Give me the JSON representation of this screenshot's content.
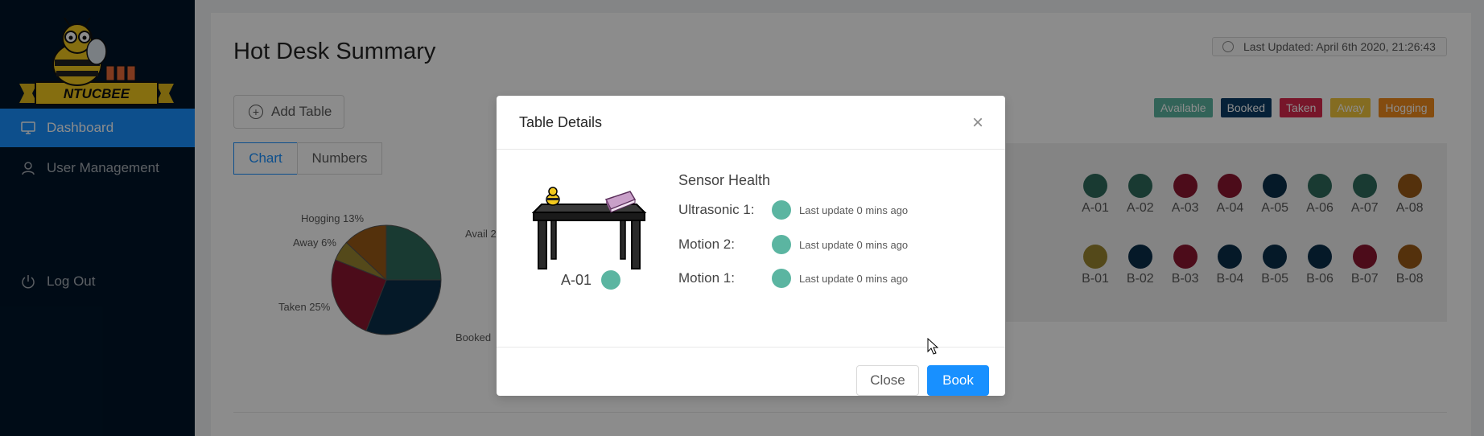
{
  "sidebar": {
    "brand": "NTUCBEE",
    "items": [
      {
        "label": "Dashboard",
        "icon": "desktop-icon",
        "active": true
      },
      {
        "label": "User Management",
        "icon": "user-icon",
        "active": false
      },
      {
        "label": "Log Out",
        "icon": "power-icon",
        "active": false
      }
    ]
  },
  "header": {
    "title": "Hot Desk Summary",
    "last_updated": "Last Updated: April 6th 2020, 21:26:43"
  },
  "toolbar": {
    "add_table_label": "Add Table",
    "tabs": [
      {
        "label": "Chart",
        "active": true
      },
      {
        "label": "Numbers",
        "active": false
      }
    ]
  },
  "legend": [
    {
      "label": "Available",
      "color": "#5bb5a1"
    },
    {
      "label": "Booked",
      "color": "#0b3d66"
    },
    {
      "label": "Taken",
      "color": "#d9294d"
    },
    {
      "label": "Away",
      "color": "#f0c53c"
    },
    {
      "label": "Hogging",
      "color": "#f08a1c"
    }
  ],
  "pie": {
    "labels": [
      "Avail 2",
      "Booked",
      "Taken 25%",
      "Away 6%",
      "Hogging 13%"
    ]
  },
  "chart_data": {
    "type": "pie",
    "slices": [
      {
        "label": "Avail",
        "value": 25,
        "color": "#2e6b5c"
      },
      {
        "label": "Booked",
        "value": 31,
        "color": "#0a2e4a"
      },
      {
        "label": "Taken",
        "value": 25,
        "color": "#8a1730"
      },
      {
        "label": "Away",
        "value": 6,
        "color": "#9a8530"
      },
      {
        "label": "Hogging",
        "value": 13,
        "color": "#9a5a16"
      }
    ]
  },
  "desks": {
    "row_a": [
      {
        "id": "A-01",
        "status": "available"
      },
      {
        "id": "A-02",
        "status": "available"
      },
      {
        "id": "A-03",
        "status": "taken"
      },
      {
        "id": "A-04",
        "status": "taken"
      },
      {
        "id": "A-05",
        "status": "booked"
      },
      {
        "id": "A-06",
        "status": "available"
      },
      {
        "id": "A-07",
        "status": "available"
      },
      {
        "id": "A-08",
        "status": "hogging"
      }
    ],
    "row_b": [
      {
        "id": "B-01",
        "status": "away"
      },
      {
        "id": "B-02",
        "status": "booked"
      },
      {
        "id": "B-03",
        "status": "taken"
      },
      {
        "id": "B-04",
        "status": "booked"
      },
      {
        "id": "B-05",
        "status": "booked"
      },
      {
        "id": "B-06",
        "status": "booked"
      },
      {
        "id": "B-07",
        "status": "taken"
      },
      {
        "id": "B-08",
        "status": "hogging"
      }
    ]
  },
  "modal": {
    "title": "Table Details",
    "table_id": "A-01",
    "sensor_title": "Sensor Health",
    "sensors": [
      {
        "name": "Ultrasonic 1:",
        "update": "Last update 0 mins ago"
      },
      {
        "name": "Motion 2:",
        "update": "Last update 0 mins ago"
      },
      {
        "name": "Motion 1:",
        "update": "Last update 0 mins ago"
      }
    ],
    "close_label": "Close",
    "book_label": "Book"
  }
}
